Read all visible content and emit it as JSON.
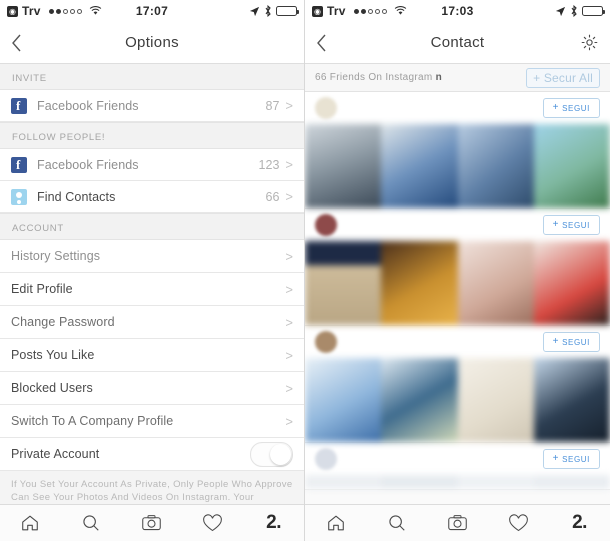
{
  "status_bar": {
    "carrier": "Trv",
    "signal_dots": [
      true,
      true,
      false,
      false,
      false
    ],
    "time_left": "17:07",
    "time_right": "17:03",
    "icons": [
      "location-arrow-icon",
      "bluetooth-icon",
      "battery-icon"
    ]
  },
  "left_screen": {
    "nav": {
      "title": "Options",
      "back_icon": "chevron-left-icon"
    },
    "sections": [
      {
        "header": "INVITE",
        "rows": [
          {
            "icon": "facebook-icon",
            "label": "Facebook Friends",
            "count": "87",
            "chevron": ">"
          }
        ]
      },
      {
        "header": "FOLLOW PEOPLE!",
        "rows": [
          {
            "icon": "facebook-icon",
            "label": "Facebook Friends",
            "count": "123",
            "chevron": ">"
          },
          {
            "icon": "contacts-icon",
            "label": "Find Contacts",
            "count": "66",
            "chevron": ">"
          }
        ]
      },
      {
        "header": "ACCOUNT",
        "rows": [
          {
            "label": "History Settings",
            "chevron": ">"
          },
          {
            "label": "Edit Profile",
            "chevron": ">"
          },
          {
            "label": "Change Password",
            "chevron": ">"
          },
          {
            "label": "Posts You Like",
            "chevron": ">"
          },
          {
            "label": "Blocked Users",
            "chevron": ">"
          },
          {
            "label": "Switch To A Company Profile",
            "chevron": ">"
          },
          {
            "label": "Private Account",
            "toggle": "off"
          }
        ]
      }
    ],
    "footnote": "If You Set Your Account As Private, Only People Who Approve Can See Your Photos And Videos On Instagram. Your Existing Followers Will Not Be Affected By The Change."
  },
  "right_screen": {
    "nav": {
      "title": "Contact",
      "back_icon": "chevron-left-icon",
      "settings_icon": "gear-icon"
    },
    "friends_bar": {
      "text_prefix": "66 Friends On Instagram",
      "text_suffix": "n",
      "action_label": "+ Secur All"
    },
    "contacts": [
      {
        "name": "",
        "subname": "",
        "follow_label": "SEGUI",
        "follow_plus": "+",
        "avatar_color": "#e8e2d2"
      },
      {
        "name": "",
        "subname": "",
        "follow_label": "SEGUI",
        "follow_plus": "+",
        "avatar_color": "#8e4a4a"
      },
      {
        "name": "",
        "subname": "",
        "follow_label": "SEGUI",
        "follow_plus": "+",
        "avatar_color": "#a98a6a"
      },
      {
        "name": "",
        "subname": "",
        "follow_label": "SEGUI",
        "follow_plus": "+",
        "avatar_color": "#d8dde6"
      }
    ]
  },
  "tab_bar": {
    "items": [
      {
        "icon": "home-icon",
        "label": ""
      },
      {
        "icon": "search-icon",
        "label": ""
      },
      {
        "icon": "camera-icon",
        "label": ""
      },
      {
        "icon": "heart-icon",
        "label": ""
      },
      {
        "icon": "profile-icon",
        "label": "2."
      }
    ]
  },
  "colors": {
    "facebook_blue": "#3b5998",
    "contacts_blue": "#9dd4ee",
    "accent_blue": "#4a90d9",
    "border": "#e3e3e3",
    "section_bg": "#f2f2f2"
  }
}
